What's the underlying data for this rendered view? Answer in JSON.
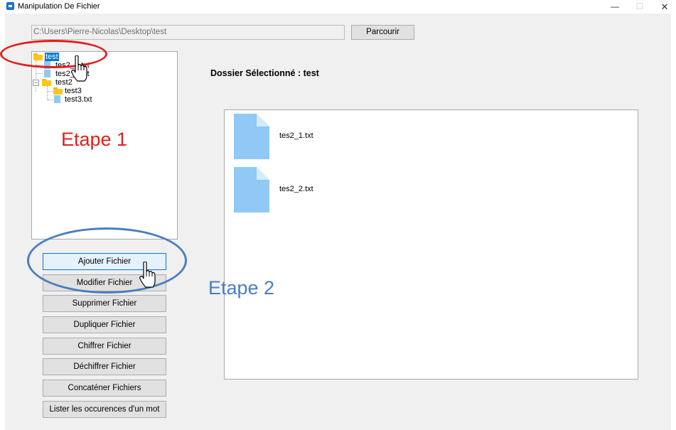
{
  "window": {
    "title": "Manipulation De Fichier",
    "minimize_glyph": "—",
    "maximize_glyph": "☐",
    "close_glyph": "✕"
  },
  "path_bar": {
    "path": "C:\\Users\\Pierre-Nicolas\\Desktop\\test",
    "browse_label": "Parcourir"
  },
  "tree": {
    "root": {
      "label": "test",
      "icon": "folder-icon",
      "selected": true
    },
    "items": [
      {
        "label": "tes2_1.txt",
        "icon": "file-icon"
      },
      {
        "label": "tes2_2.txt",
        "icon": "file-icon"
      },
      {
        "label": "test2",
        "icon": "folder-icon",
        "expander": "−"
      },
      {
        "label": "test3",
        "icon": "folder-icon"
      },
      {
        "label": "test3.txt",
        "icon": "file-icon"
      }
    ]
  },
  "actions": [
    {
      "label": "Ajouter Fichier"
    },
    {
      "label": "Modifier Fichier"
    },
    {
      "label": "Supprimer Fichier"
    },
    {
      "label": "Dupliquer Fichier"
    },
    {
      "label": "Chiffrer Fichier"
    },
    {
      "label": "Déchiffrer Fichier"
    },
    {
      "label": "Concaténer Fichiers"
    },
    {
      "label": "Lister les occurences d'un mot"
    }
  ],
  "selected_folder": {
    "label": "Dossier Sélectionné : test"
  },
  "files": [
    {
      "name": "tes2_1.txt",
      "icon": "file-icon"
    },
    {
      "name": "tes2_2.txt",
      "icon": "file-icon"
    }
  ],
  "annotations": {
    "step1": "Etape 1",
    "step2": "Etape 2",
    "step1_color": "#e02020",
    "step2_color": "#4a7ec0"
  },
  "colors": {
    "selection": "#0078d7",
    "file_icon": "#90c8f6",
    "folder_icon": "#ffc61a"
  }
}
